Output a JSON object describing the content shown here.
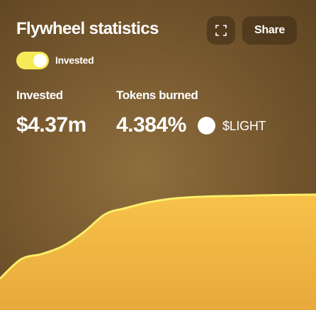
{
  "header": {
    "title": "Flywheel statistics",
    "share_label": "Share",
    "expand_icon": "expand-icon"
  },
  "toggle": {
    "label": "Invested",
    "on": true
  },
  "stats": {
    "invested": {
      "label": "Invested",
      "value": "$4.37m"
    },
    "tokens_burned": {
      "label": "Tokens burned",
      "value": "4.384%",
      "token": "$LIGHT"
    }
  },
  "colors": {
    "accent": "#f6ea58",
    "background": "#7a5b30"
  },
  "chart_data": {
    "type": "area",
    "x": [
      0,
      1,
      2,
      3,
      4,
      5,
      6,
      7,
      8,
      9,
      10,
      11,
      12,
      13,
      14,
      15
    ],
    "values": [
      0.05,
      0.27,
      0.33,
      0.42,
      0.58,
      0.78,
      0.85,
      0.91,
      0.95,
      0.97,
      0.98,
      0.985,
      0.99,
      0.995,
      0.998,
      1.0
    ],
    "title": "",
    "xlabel": "",
    "ylabel": "",
    "ylim": [
      0,
      1
    ],
    "grid": false,
    "legend": "none"
  }
}
